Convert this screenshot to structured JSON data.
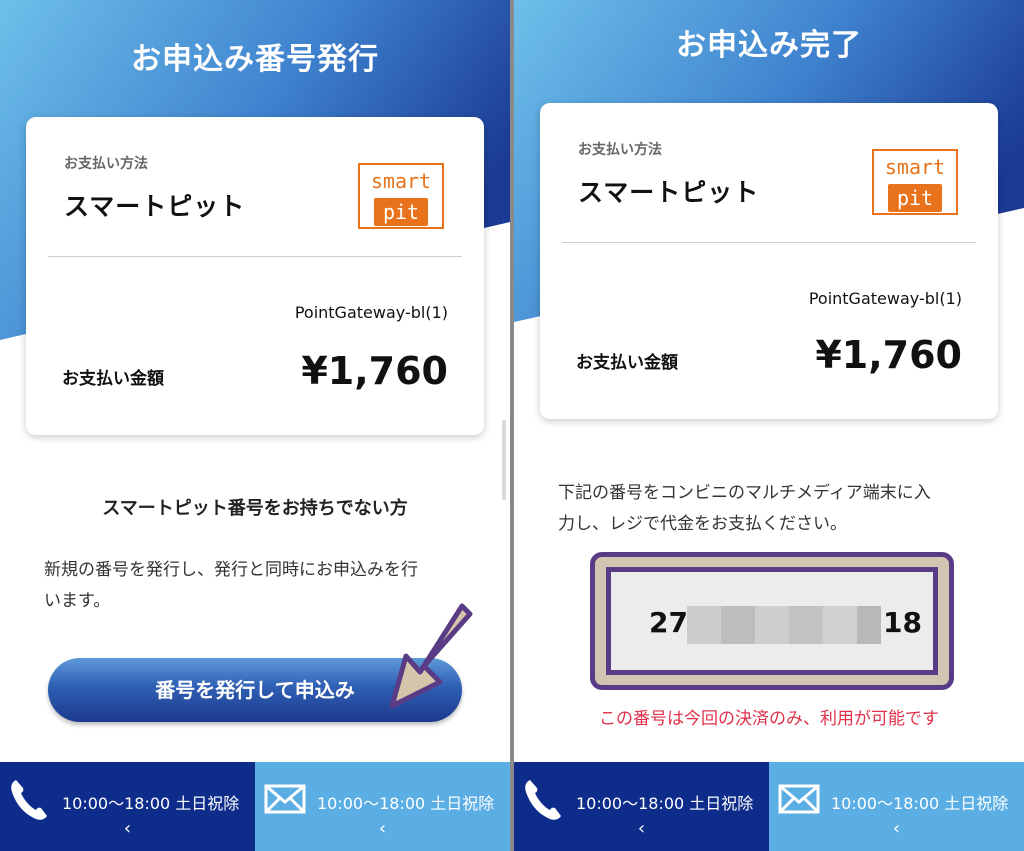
{
  "left": {
    "title": "お申込み番号発行",
    "payment_method_label": "お支払い方法",
    "payment_method_name": "スマートピット",
    "logo": {
      "top": "smart",
      "bottom": "pit"
    },
    "merchant": "PointGateway-bl(1)",
    "amount_label": "お支払い金額",
    "amount": "¥1,760",
    "subheading": "スマートピット番号をお持ちでない方",
    "description_line1": "新規の番号を発行し、発行と同時にお申込みを行",
    "description_line2": "います。",
    "button_label": "番号を発行して申込み"
  },
  "right": {
    "title": "お申込み完了",
    "payment_method_label": "お支払い方法",
    "payment_method_name": "スマートピット",
    "logo": {
      "top": "smart",
      "bottom": "pit"
    },
    "merchant": "PointGateway-bl(1)",
    "amount_label": "お支払い金額",
    "amount": "¥1,760",
    "instruction_line1": "下記の番号をコンビニのマルチメディア端末に入",
    "instruction_line2": "力し、レジで代金をお支払ください。",
    "number_prefix": "27",
    "number_suffix": "18",
    "warning": "この番号は今回の決済のみ、利用が可能です"
  },
  "footer": {
    "phone_hours": "10:00〜18:00 土日祝除",
    "mail_hours": "10:00〜18:00 土日祝除",
    "chevron": "‹",
    "phone_icon": "phone-icon",
    "mail_icon": "mail-icon"
  },
  "colors": {
    "header_light": "#66b6e6",
    "header_dark": "#1b3a94",
    "footer_dark": "#0e2c8a",
    "footer_light": "#5aaee3",
    "brand_orange": "#e8731c",
    "number_frame": "#5a3c86",
    "warning_red": "#e0304a"
  }
}
